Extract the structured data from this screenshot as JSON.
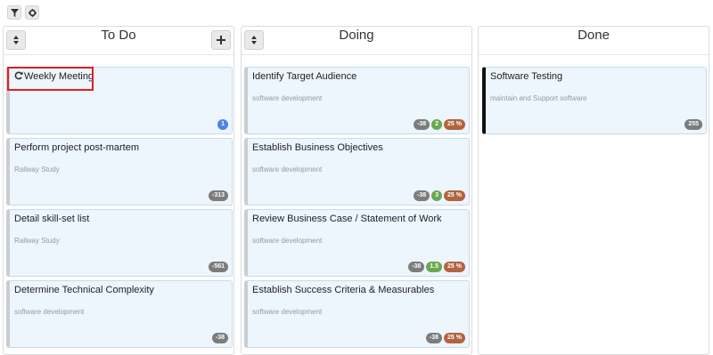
{
  "toolbar": {
    "filter_icon": "filter-icon",
    "settings_icon": "gear-icon"
  },
  "columns": [
    {
      "title": "To Do",
      "cards": [
        {
          "title": "Weekly Meeting",
          "subtitle": "",
          "badges": [
            "1"
          ],
          "recurring": true
        },
        {
          "title": "Perform project post-martem",
          "subtitle": "Railway Study",
          "badges": [
            "-313"
          ]
        },
        {
          "title": "Detail skill-set list",
          "subtitle": "Railway Study",
          "badges": [
            "-561"
          ]
        },
        {
          "title": "Determine Technical Complexity",
          "subtitle": "software development",
          "badges": [
            "-38"
          ]
        }
      ]
    },
    {
      "title": "Doing",
      "cards": [
        {
          "title": "Identify Target Audience",
          "subtitle": "software development",
          "badges": [
            "-38",
            "2",
            "25 %"
          ]
        },
        {
          "title": "Establish Business Objectives",
          "subtitle": "software development",
          "badges": [
            "-38",
            "3",
            "25 %"
          ]
        },
        {
          "title": "Review Business Case / Statement of Work",
          "subtitle": "software development",
          "badges": [
            "-38",
            "1.5",
            "25 %"
          ]
        },
        {
          "title": "Establish Success Criteria & Measurables",
          "subtitle": "software development",
          "badges": [
            "-38",
            "25 %"
          ]
        }
      ]
    },
    {
      "title": "Done",
      "cards": [
        {
          "title": "Software Testing",
          "subtitle": "maintain and Support software",
          "badges": [
            "255"
          ]
        }
      ]
    }
  ],
  "colors": {
    "card_bg": "#edf5fd",
    "highlight": "#e02020",
    "badge_gray": "#7c7c7c",
    "badge_green": "#6aa84f",
    "badge_orange": "#b2633f",
    "badge_blue": "#4a86e8"
  }
}
